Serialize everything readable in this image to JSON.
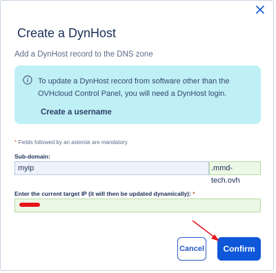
{
  "dialog": {
    "title": "Create a DynHost",
    "subtitle": "Add a DynHost record to the DNS zone",
    "close_icon": "close-icon"
  },
  "info": {
    "icon": "info-icon",
    "text": "To update a DynHost record from software other than the OVHcloud Control Panel, you will need a DynHost login.",
    "link_label": "Create a username"
  },
  "form": {
    "mandatory_star": "*",
    "mandatory_note": "Fields followed by an asterisk are mandatory.",
    "subdomain": {
      "label": "Sub-domain:",
      "value": "myip",
      "suffix": ".mmd-tech.ovh"
    },
    "target_ip": {
      "label": "Enter the current target IP (it will then be updated dynamically):",
      "required_star": "*"
    }
  },
  "actions": {
    "cancel_label": "Cancel",
    "confirm_label": "Confirm"
  },
  "colors": {
    "primary": "#0d57d8",
    "info_background": "#bff0f6",
    "annotation_red": "#e8141b"
  }
}
